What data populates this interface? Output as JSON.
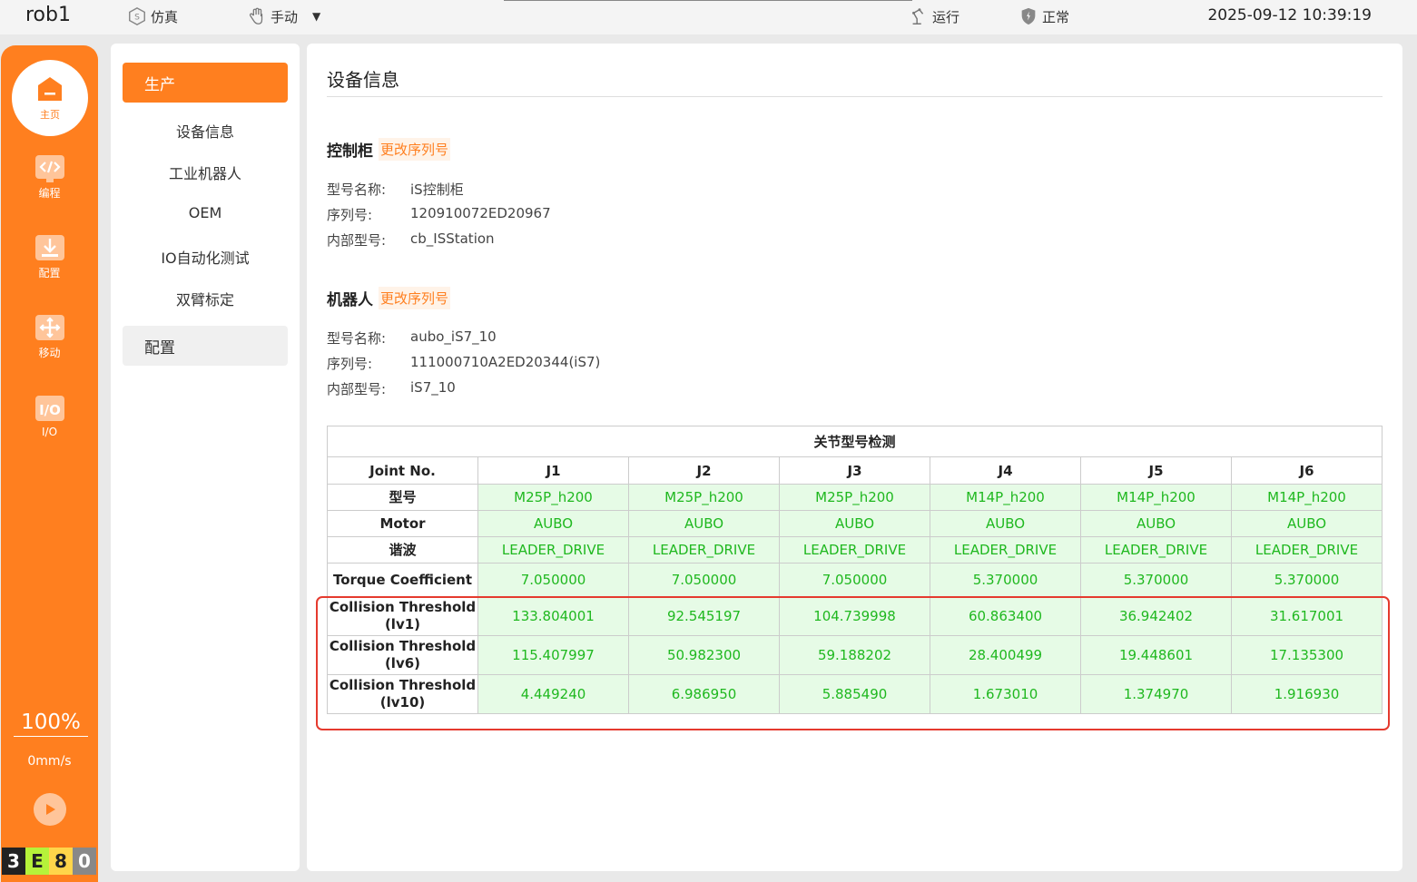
{
  "topbar": {
    "robot_name": "rob1",
    "sim_label": "仿真",
    "mode_label": "手动",
    "run_label": "运行",
    "status_label": "正常",
    "datetime": "2025-09-12 10:39:19"
  },
  "leftbar": {
    "home_label": "主页",
    "items": [
      {
        "label": "编程",
        "icon": "code-icon"
      },
      {
        "label": "配置",
        "icon": "download-icon"
      },
      {
        "label": "移动",
        "icon": "move-icon"
      },
      {
        "label": "I/O",
        "icon": "io-icon"
      }
    ],
    "speed_percent": "100%",
    "speed_value": "0mm/s",
    "badges": [
      "3",
      "E",
      "8",
      "0"
    ]
  },
  "menu": {
    "group1": "生产",
    "subitems": [
      "设备信息",
      "工业机器人",
      "OEM",
      "IO自动化测试",
      "双臂标定"
    ],
    "group2": "配置"
  },
  "main": {
    "title": "设备信息",
    "controller": {
      "title": "控制柜",
      "link": "更改序列号",
      "fields": [
        {
          "k": "型号名称:",
          "v": "iS控制柜"
        },
        {
          "k": "序列号:",
          "v": "120910072ED20967"
        },
        {
          "k": "内部型号:",
          "v": "cb_ISStation"
        }
      ]
    },
    "robot": {
      "title": "机器人",
      "link": "更改序列号",
      "fields": [
        {
          "k": "型号名称:",
          "v": "aubo_iS7_10"
        },
        {
          "k": "序列号:",
          "v": "111000710A2ED20344(iS7)"
        },
        {
          "k": "内部型号:",
          "v": "iS7_10"
        }
      ]
    },
    "table": {
      "caption": "关节型号检测",
      "headers": [
        "Joint No.",
        "J1",
        "J2",
        "J3",
        "J4",
        "J5",
        "J6"
      ],
      "rows": [
        {
          "label": "型号",
          "values": [
            "M25P_h200",
            "M25P_h200",
            "M25P_h200",
            "M14P_h200",
            "M14P_h200",
            "M14P_h200"
          ]
        },
        {
          "label": "Motor",
          "values": [
            "AUBO",
            "AUBO",
            "AUBO",
            "AUBO",
            "AUBO",
            "AUBO"
          ]
        },
        {
          "label": "谐波",
          "values": [
            "LEADER_DRIVE",
            "LEADER_DRIVE",
            "LEADER_DRIVE",
            "LEADER_DRIVE",
            "LEADER_DRIVE",
            "LEADER_DRIVE"
          ]
        },
        {
          "label": "Torque Coefficient",
          "values": [
            "7.050000",
            "7.050000",
            "7.050000",
            "5.370000",
            "5.370000",
            "5.370000"
          ]
        },
        {
          "label": "Collision Threshold (lv1)",
          "values": [
            "133.804001",
            "92.545197",
            "104.739998",
            "60.863400",
            "36.942402",
            "31.617001"
          ]
        },
        {
          "label": "Collision Threshold (lv6)",
          "values": [
            "115.407997",
            "50.982300",
            "59.188202",
            "28.400499",
            "19.448601",
            "17.135300"
          ]
        },
        {
          "label": "Collision Threshold (lv10)",
          "values": [
            "4.449240",
            "6.986950",
            "5.885490",
            "1.673010",
            "1.374970",
            "1.916930"
          ]
        }
      ]
    }
  },
  "colors": {
    "accent": "#ff7f1f",
    "value_green": "#1fb81f",
    "value_bg": "#e6fbe6",
    "highlight_red": "#e53a2e"
  }
}
